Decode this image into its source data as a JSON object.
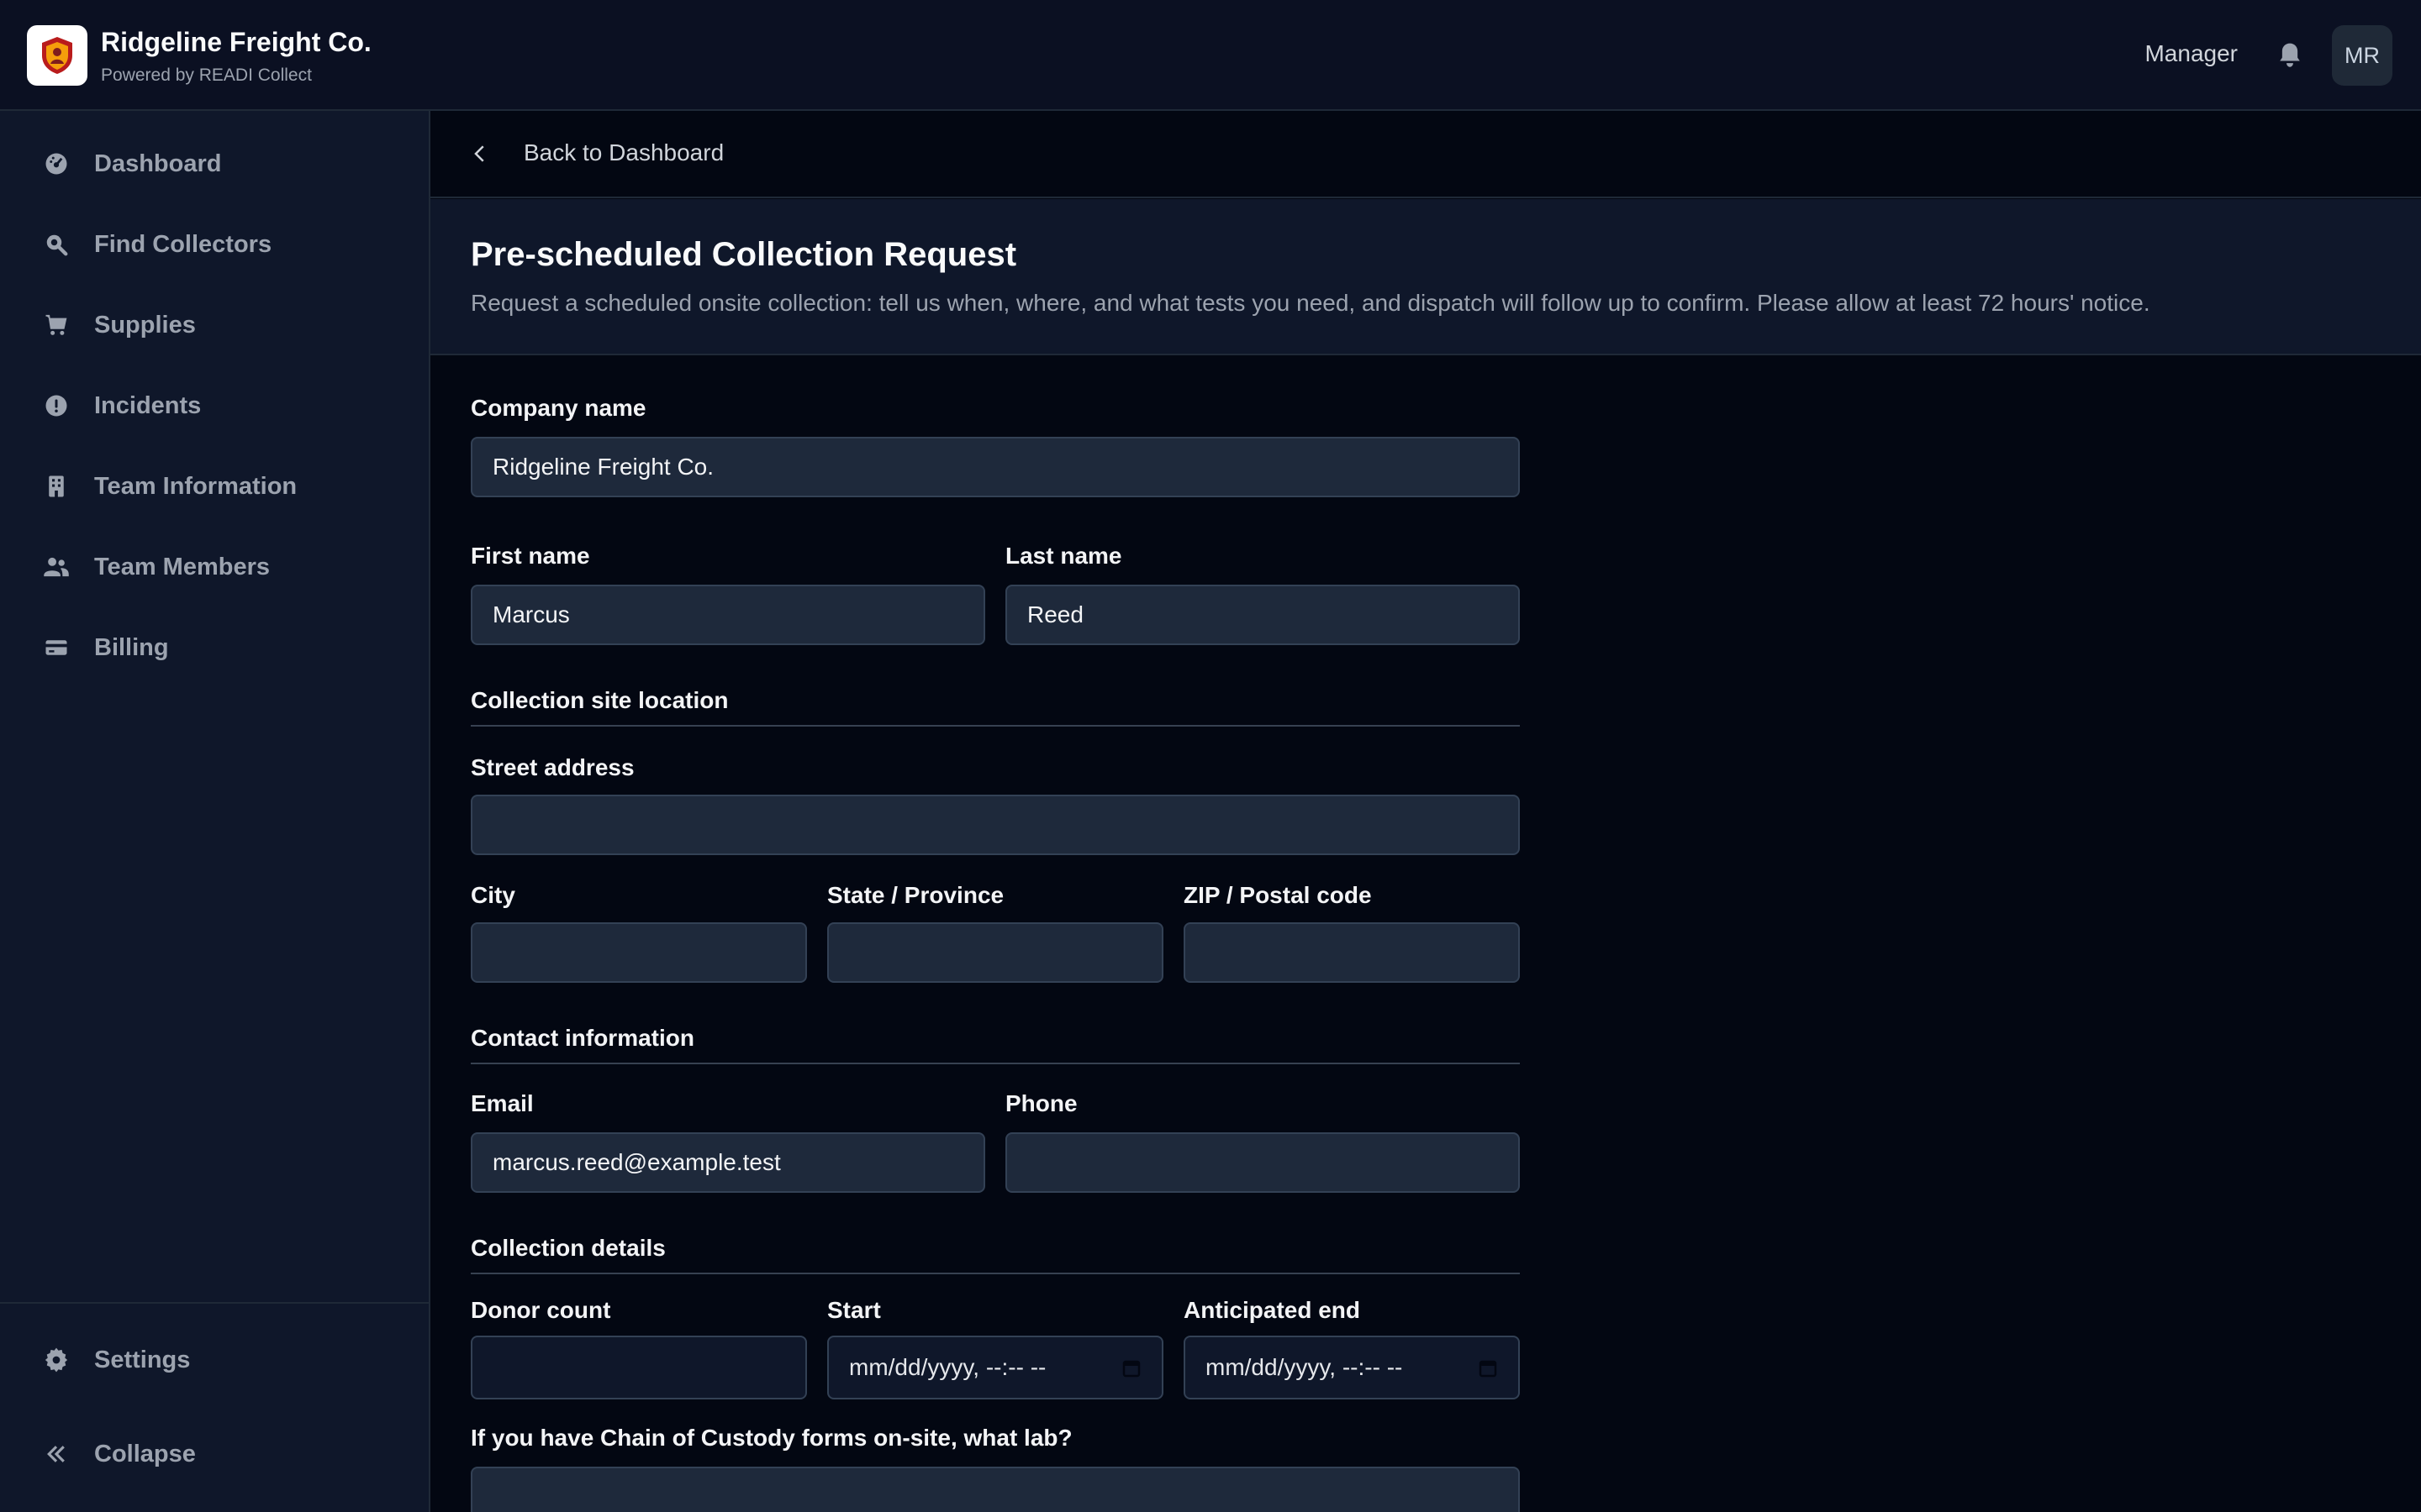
{
  "header": {
    "brand_title": "Ridgeline Freight Co.",
    "brand_subtitle": "Powered by READI Collect",
    "role": "Manager",
    "avatar_initials": "MR",
    "logo_icon": "shield-logo-icon",
    "bell_icon": "bell-icon"
  },
  "sidebar": {
    "items": [
      {
        "label": "Dashboard",
        "icon": "dashboard-icon"
      },
      {
        "label": "Find Collectors",
        "icon": "search-icon"
      },
      {
        "label": "Supplies",
        "icon": "cart-icon"
      },
      {
        "label": "Incidents",
        "icon": "alert-icon"
      },
      {
        "label": "Team Information",
        "icon": "building-icon"
      },
      {
        "label": "Team Members",
        "icon": "users-icon"
      },
      {
        "label": "Billing",
        "icon": "credit-card-icon"
      }
    ],
    "settings_label": "Settings",
    "collapse_label": "Collapse"
  },
  "backbar": {
    "label": "Back to Dashboard"
  },
  "page": {
    "title": "Pre-scheduled Collection Request",
    "description": "Request a scheduled onsite collection: tell us when, where, and what tests you need, and dispatch will follow up to confirm. Please allow at least 72 hours' notice."
  },
  "form": {
    "company_label": "Company name",
    "company_value": "Ridgeline Freight Co.",
    "first_label": "First name",
    "first_value": "Marcus",
    "last_label": "Last name",
    "last_value": "Reed",
    "section_location": "Collection site location",
    "street_label": "Street address",
    "street_value": "",
    "city_label": "City",
    "city_value": "",
    "state_label": "State / Province",
    "state_value": "",
    "zip_label": "ZIP / Postal code",
    "zip_value": "",
    "section_contact": "Contact information",
    "email_label": "Email",
    "email_value": "marcus.reed@example.test",
    "phone_label": "Phone",
    "phone_value": "",
    "section_details": "Collection details",
    "donor_label": "Donor count",
    "donor_value": "",
    "start_label": "Start",
    "start_placeholder": "mm/dd/yyyy, --:-- --",
    "end_label": "Anticipated end",
    "end_placeholder": "mm/dd/yyyy, --:-- --",
    "lab_label": "If you have Chain of Custody forms on-site, what lab?",
    "lab_value": ""
  }
}
